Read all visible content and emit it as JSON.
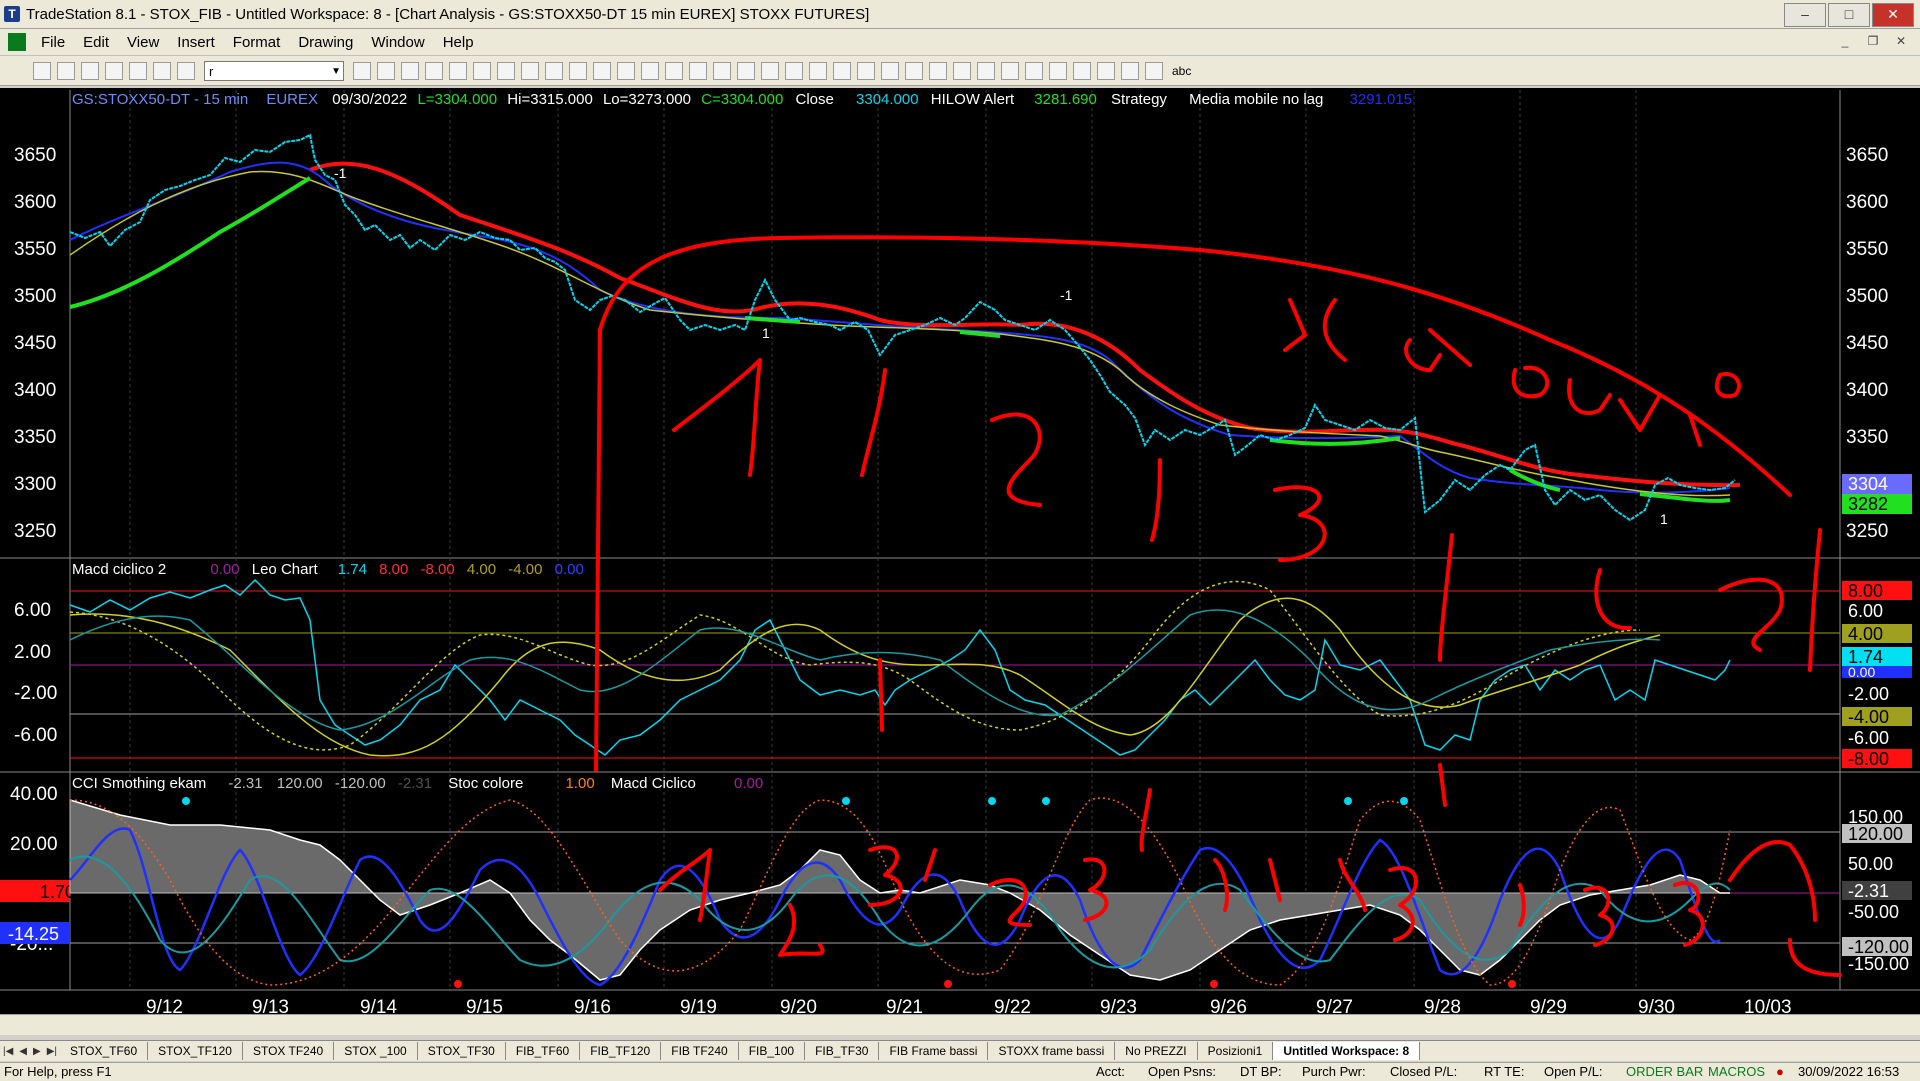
{
  "window": {
    "title": "TradeStation 8.1 - STOX_FIB - Untitled Workspace: 8 - [Chart Analysis - GS:STOXX50-DT  15 min  EUREX] STOXX FUTURES]",
    "minimize": "–",
    "maximize": "□",
    "close": "✕"
  },
  "menu": {
    "items": [
      "File",
      "Edit",
      "View",
      "Insert",
      "Format",
      "Drawing",
      "Window",
      "Help"
    ],
    "mdi_buttons": [
      "_",
      "❐",
      "✕"
    ]
  },
  "toolbar": {
    "combo_value": "r",
    "abc_label": "abc"
  },
  "chart": {
    "header": {
      "symbol": "GS:STOXX50-DT - 15 min",
      "exchange": "EUREX",
      "date": "09/30/2022",
      "last": "L=3304.000",
      "high": "Hi=3315.000",
      "low": "Lo=3273.000",
      "close_val": "C=3304.000",
      "close_label": "Close",
      "close_num": "3304.000",
      "hilow": "HILOW Alert",
      "hilow_val": "3281.690",
      "strategy": "Strategy",
      "media": "Media mobile no lag",
      "media_val": "3291.015"
    },
    "price_axis": [
      "3650",
      "3600",
      "3550",
      "3500",
      "3450",
      "3400",
      "3350",
      "3300",
      "3250"
    ],
    "price_tag_close": "3304",
    "price_tag_hilow": "3282",
    "trade_markers": [
      "-1",
      "1",
      "-1",
      "1"
    ],
    "colors": {
      "price": "#00d8f0",
      "ma_blue": "#2030ff",
      "ma_yellow": "#c8c830",
      "ma_red": "#ff1010",
      "ma_green": "#20e020"
    }
  },
  "macd_panel": {
    "title": "Macd ciclico 2",
    "v1": "0.00",
    "leo": "Leo Chart",
    "v2": "1.74",
    "v3": "8.00",
    "v4": "-8.00",
    "v5": "4.00",
    "v6": "-4.00",
    "v7": "0.00",
    "left_axis": [
      "6.00",
      "2.00",
      "-2.00",
      "-6.00"
    ],
    "right_tags": [
      "8.00",
      "6.00",
      "4.00",
      "1.74",
      "0.00",
      "-2.00",
      "-4.00",
      "-6.00",
      "-8.00"
    ]
  },
  "cci_panel": {
    "title": "CCI Smothing ekam",
    "v1": "-2.31",
    "v2": "120.00",
    "v3": "-120.00",
    "v4": "-2.31",
    "stoc": "Stoc colore",
    "stoc_val": "1.00",
    "macd_label": "Macd Ciclico",
    "macd_val": "0.00",
    "left_axis": [
      "40.00",
      "20.00",
      "-20..."
    ],
    "left_tag_red": "1.70",
    "left_tag_blue": "-14.25",
    "right_tags": [
      "150.00",
      "120.00",
      "50.00",
      "-2.31",
      "-50.00",
      "-120.00",
      "-150.00"
    ]
  },
  "x_axis": [
    "9/12",
    "9/13",
    "9/14",
    "9/15",
    "9/16",
    "9/19",
    "9/20",
    "9/21",
    "9/22",
    "9/23",
    "9/26",
    "9/27",
    "9/28",
    "9/29",
    "9/30",
    "10/03"
  ],
  "tabs": [
    "STOX_TF60",
    "STOX_TF120",
    "STOX TF240",
    "STOX _100",
    "STOX_TF30",
    "FIB_TF60",
    "FIB_TF120",
    "FIB TF240",
    "FIB_100",
    "FIB_TF30",
    "FIB Frame bassi",
    "STOXX frame bassi",
    "No PREZZI",
    "Posizioni1",
    "Untitled Workspace: 8"
  ],
  "status": {
    "help": "For Help, press F1",
    "acct": "Acct:",
    "open_psns": "Open Psns:",
    "dt_bp": "DT BP:",
    "purch": "Purch Pwr:",
    "closed": "Closed P/L:",
    "rt_te": "RT TE:",
    "open_pl": "Open P/L:",
    "order_bar": "ORDER BAR",
    "macros": "MACROS",
    "datetime": "30/09/2022 16:53"
  }
}
